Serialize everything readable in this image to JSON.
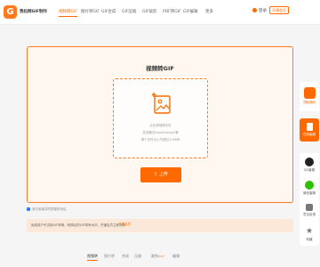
{
  "header": {
    "logo_text": "G",
    "brand": "我拉网GIF制作",
    "nav": [
      "视频转GIF",
      "图片转GIF",
      "GIF合成",
      "GIF压缩",
      "GIF裁剪",
      "PDF转GIF",
      "GIF编辑",
      "更多"
    ],
    "login": "登录",
    "vip": "开通会员"
  },
  "card": {
    "title": "视频转GIF",
    "hint1": "点击或拖拽文件",
    "hint2": "支持格式mp4/mov/avi等",
    "hint3": "单个文件大小不超过100MB",
    "upload": "上传"
  },
  "agreement": "我已阅读并同意服务协议",
  "notice": {
    "text": "免费用户可试用GIF转换，转换后的GIF带有水印，开通会员立即去除",
    "button": "开通会员"
  },
  "bottom_tabs": [
    "视频转",
    "图片转",
    "合成",
    "压缩",
    "裁剪",
    "编辑"
  ],
  "bottom_badge": "HOT",
  "sidebar": {
    "items": [
      "领取福利",
      "在线客服",
      "QQ客服",
      "微信客服",
      "意见反馈",
      "收藏"
    ]
  },
  "colors": {
    "accent": "#ff6a00",
    "card_bg": "#fff7f0",
    "notice_bg": "#fbe8d8"
  }
}
